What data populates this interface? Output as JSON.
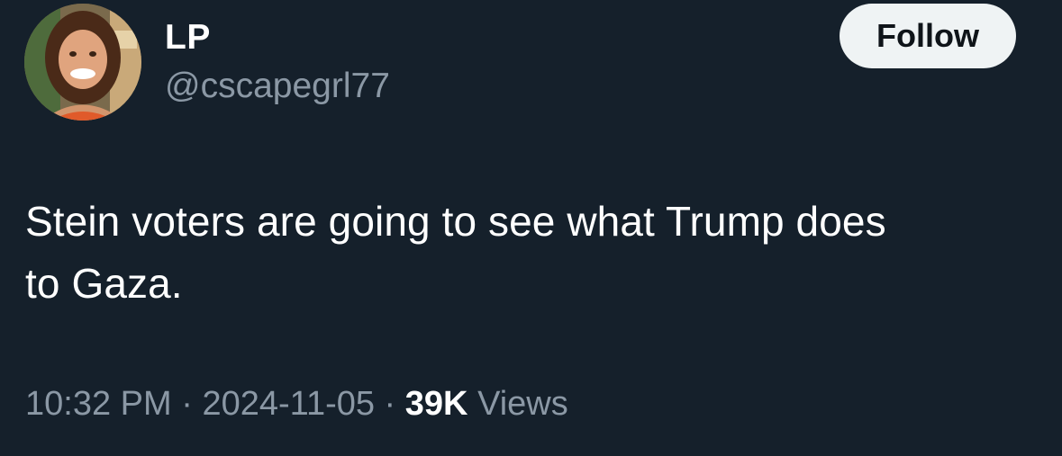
{
  "author": {
    "display_name": "LP",
    "handle": "@cscapegrl77"
  },
  "follow_button": {
    "label": "Follow"
  },
  "tweet": {
    "text_line1": "Stein voters are going to see what Trump does",
    "text_line2": "to Gaza."
  },
  "meta": {
    "time": "10:32 PM",
    "separator": " · ",
    "date": "2024-11-05",
    "views_count": "39K",
    "views_label": "Views"
  },
  "colors": {
    "background": "#15202b",
    "primary_text": "#ffffff",
    "secondary_text": "#8b98a5",
    "button_bg": "#eff3f4",
    "button_text": "#0f1419"
  }
}
